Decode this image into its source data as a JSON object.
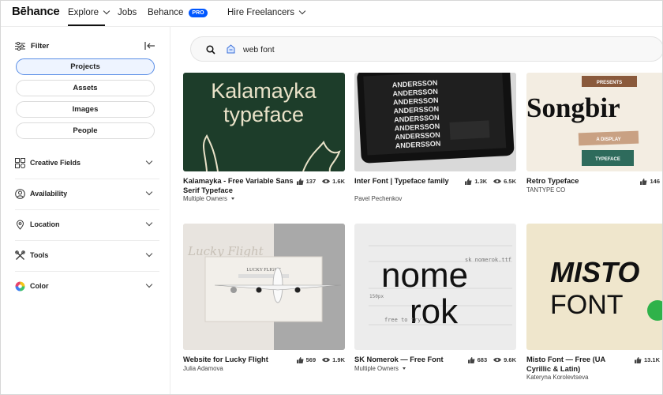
{
  "header": {
    "logo": "Bēhance",
    "nav": {
      "explore": "Explore",
      "jobs": "Jobs",
      "behance": "Behance",
      "pro_badge": "PRO",
      "hire": "Hire Freelancers"
    }
  },
  "sidebar": {
    "filter_label": "Filter",
    "pills": {
      "projects": "Projects",
      "assets": "Assets",
      "images": "Images",
      "people": "People"
    },
    "active_pill": "Projects",
    "sections": {
      "creative_fields": "Creative Fields",
      "availability": "Availability",
      "location": "Location",
      "tools": "Tools",
      "color": "Color"
    }
  },
  "search": {
    "query": "web font"
  },
  "cards": [
    {
      "title": "Kalamayka - Free Variable Sans Serif Typeface",
      "owner": "Multiple Owners",
      "likes": "137",
      "views": "1.6K",
      "thumb_text_1": "Kalamayka",
      "thumb_text_2": "typeface"
    },
    {
      "title": "Inter Font | Typeface family",
      "owner": "Pavel Pechenkov",
      "likes": "1.3K",
      "views": "6.5K",
      "thumb_text_1": "ANDERSSON"
    },
    {
      "title": "Retro Typeface",
      "owner": "TANTYPE CO",
      "likes": "146",
      "thumb_text_1": "PRESENTS",
      "thumb_text_2": "Songbir",
      "thumb_text_3": "A DISPLAY",
      "thumb_text_4": "TYPEFACE"
    },
    {
      "title": "Website for Lucky Flight",
      "owner": "Julia Adamova",
      "likes": "569",
      "views": "1.9K",
      "thumb_text_1": "Lucky Flight",
      "thumb_text_2": "LUCKY FLIGHT"
    },
    {
      "title": "SK Nomerok — Free Font",
      "owner": "Multiple Owners",
      "likes": "683",
      "views": "9.6K",
      "thumb_text_1": "nome",
      "thumb_text_2": "rok",
      "thumb_text_3": "sk nomerok.ttf",
      "thumb_text_4": "free to try",
      "thumb_text_5": "150px"
    },
    {
      "title": "Misto Font — Free (UA Cyrillic & Latin)",
      "owner": "Kateryna Korolevtseva",
      "likes": "13.1K",
      "thumb_text_1": "MISTO",
      "thumb_text_2": "FONT"
    }
  ],
  "colors": {
    "brand": "#0057ff",
    "kalamayka_bg": "#1d3d2a",
    "songbird_bg": "#f3ede2",
    "misto_bg": "#efe6cc",
    "active_pill_border": "#5a8ee6"
  }
}
